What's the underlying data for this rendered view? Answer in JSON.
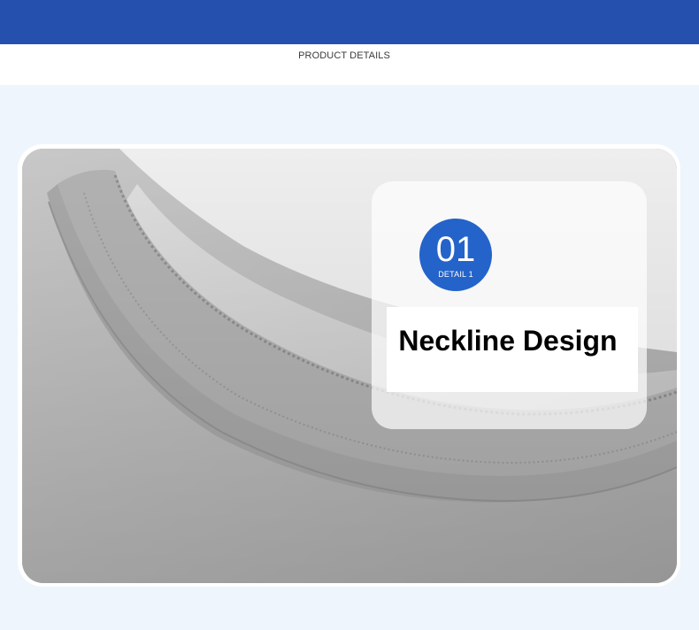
{
  "colors": {
    "top_bar": "#2550ad",
    "page_background": "#eef5fd",
    "badge": "#2463c9",
    "fabric": "#b6b6b6"
  },
  "header": {
    "section_title": "PRODUCT DETAILS"
  },
  "detail": {
    "number": "01",
    "label": "DETAIL 1",
    "title": "Neckline Design"
  },
  "photo": {
    "subject": "grey-cotton-tshirt-neckline"
  }
}
